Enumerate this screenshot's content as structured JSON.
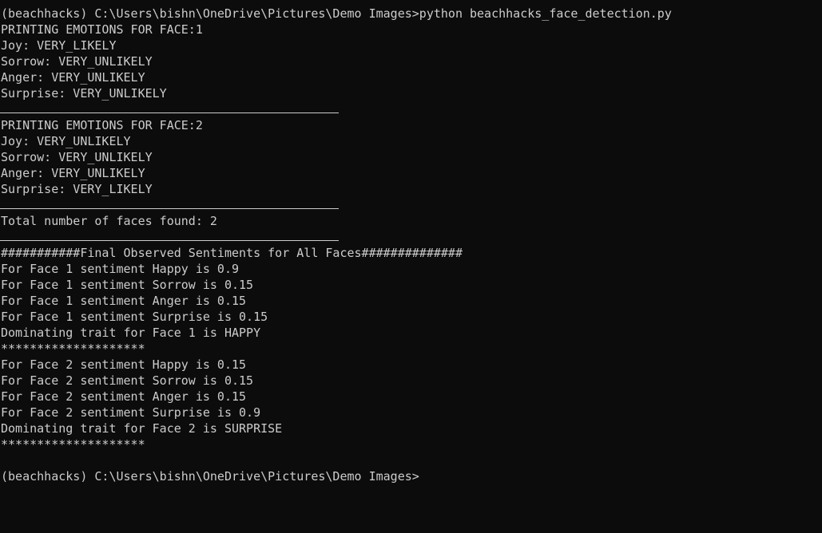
{
  "console": {
    "command_line": "(beachhacks) C:\\Users\\bishn\\OneDrive\\Pictures\\Demo Images>python beachhacks_face_detection.py",
    "face1": {
      "header": "PRINTING EMOTIONS FOR FACE:1",
      "joy": "Joy: VERY_LIKELY",
      "sorrow": "Sorrow: VERY_UNLIKELY",
      "anger": "Anger: VERY_UNLIKELY",
      "surprise": "Surprise: VERY_UNLIKELY"
    },
    "face2": {
      "header": "PRINTING EMOTIONS FOR FACE:2",
      "joy": "Joy: VERY_UNLIKELY",
      "sorrow": "Sorrow: VERY_UNLIKELY",
      "anger": "Anger: VERY_UNLIKELY",
      "surprise": "Surprise: VERY_LIKELY"
    },
    "total_faces": "Total number of faces found: 2",
    "final_header": "###########Final Observed Sentiments for All Faces##############",
    "face1_sentiments": {
      "happy": "For Face 1 sentiment Happy is 0.9",
      "sorrow": "For Face 1 sentiment Sorrow is 0.15",
      "anger": "For Face 1 sentiment Anger is 0.15",
      "surprise": "For Face 1 sentiment Surprise is 0.15",
      "dominant": "Dominating trait for Face 1 is HAPPY"
    },
    "face2_sentiments": {
      "happy": "For Face 2 sentiment Happy is 0.15",
      "sorrow": "For Face 2 sentiment Sorrow is 0.15",
      "anger": "For Face 2 sentiment Anger is 0.15",
      "surprise": "For Face 2 sentiment Surprise is 0.9",
      "dominant": "Dominating trait for Face 2 is SURPRISE"
    },
    "stars": "********************",
    "prompt": "(beachhacks) C:\\Users\\bishn\\OneDrive\\Pictures\\Demo Images>"
  },
  "colors": {
    "background": "#0c0c0c",
    "text": "#cccccc"
  }
}
